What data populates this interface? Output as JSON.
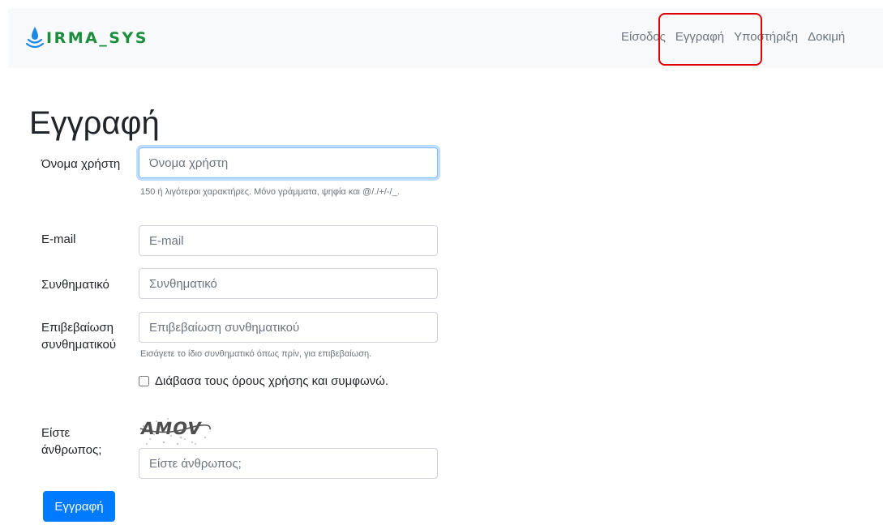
{
  "header": {
    "brand": "IRMA_SYS",
    "nav": [
      "Είσοδος",
      "Εγγραφή",
      "Υποστήριξη",
      "Δοκιμή"
    ]
  },
  "colors": {
    "brand_green": "#1a8e3c",
    "logo_blue": "#1e88e5",
    "primary": "#007bff",
    "highlight": "#e00000"
  },
  "form": {
    "title": "Εγγραφή",
    "username": {
      "label": "Όνομα χρήστη",
      "placeholder": "Όνομα χρήστη",
      "help": "150 ή λιγότεροι χαρακτήρες. Μόνο γράμματα, ψηφία και @/./+/-/_."
    },
    "email": {
      "label": "E-mail",
      "placeholder": "E-mail"
    },
    "password": {
      "label": "Συνθηματικό",
      "placeholder": "Συνθηματικό"
    },
    "password2": {
      "label": "Επιβεβαίωση συνθηματικού",
      "placeholder": "Επιβεβαίωση συνθηματικού",
      "help": "Εισάγετε το ίδιο συνθηματικό όπως πρίν, για επιβεβαίωση."
    },
    "terms": {
      "label": "Διάβασα τους όρους χρήσης και συμφωνώ.",
      "checked": false
    },
    "captcha": {
      "label": "Είστε άνθρωπος;",
      "image_text": "AMOV",
      "placeholder": "Είστε άνθρωπος;"
    },
    "submit": "Εγγραφή"
  }
}
